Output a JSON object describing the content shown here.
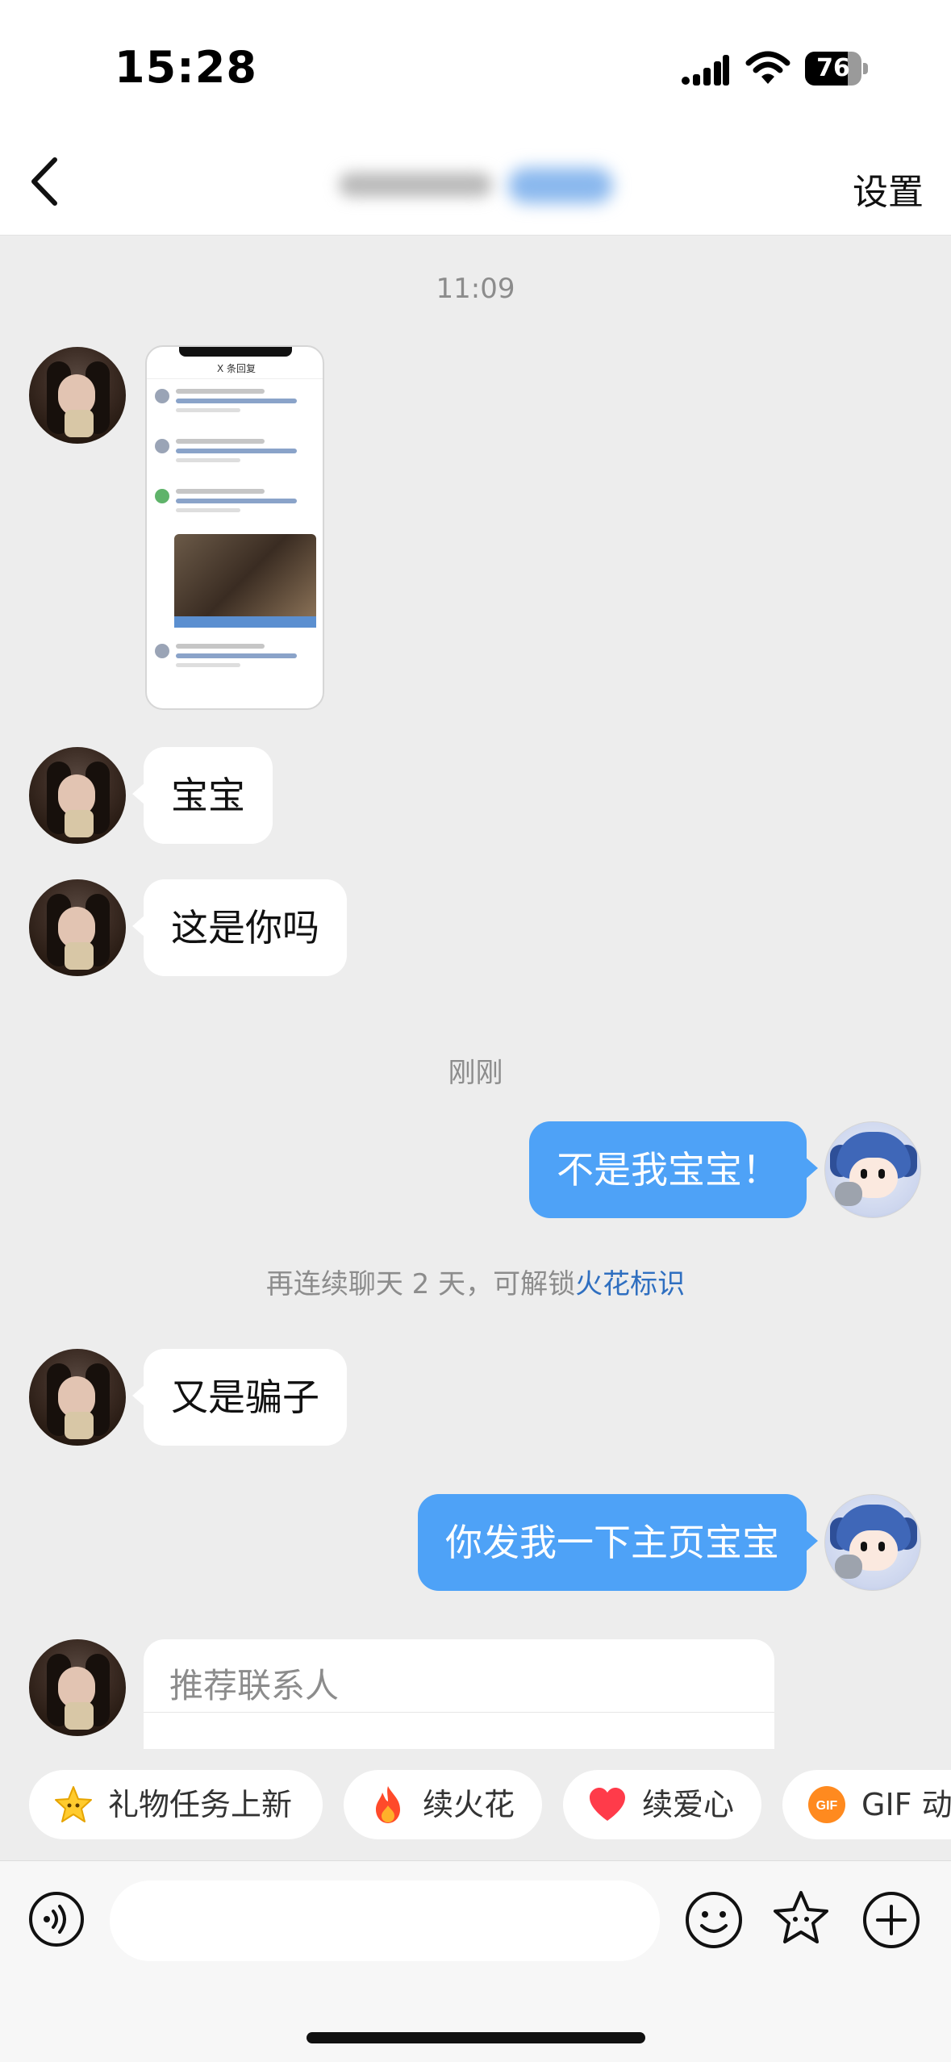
{
  "status_bar": {
    "time": "15:28",
    "battery": "76",
    "battery_level": 0.76
  },
  "header": {
    "back_icon": "chevron-left-icon",
    "title": "",
    "settings_label": "设置"
  },
  "chat": {
    "timestamp_1": "11:09",
    "image_header": "X 条回复",
    "msg_baobao": "宝宝",
    "msg_zheshini": "这是你吗",
    "timestamp_2": "刚刚",
    "msg_bushiwo": "不是我宝宝！",
    "notice_prefix": "再连续聊天 2 天，可解锁",
    "notice_link": "火花标识",
    "msg_youshipianzi": "又是骗子",
    "msg_fawo": "你发我一下主页宝宝",
    "contact_card_title": "推荐联系人"
  },
  "chips": [
    {
      "label": "礼物任务上新",
      "icon": "star-badge-icon"
    },
    {
      "label": "续火花",
      "icon": "fire-icon"
    },
    {
      "label": "续爱心",
      "icon": "heart-icon"
    },
    {
      "label": "GIF 动",
      "icon": "gif-icon",
      "icon_text": "GIF"
    }
  ],
  "input": {
    "placeholder": "",
    "value": ""
  },
  "colors": {
    "accent": "#4ea2f7",
    "link": "#2f6fc0",
    "chat_bg": "#ededed"
  }
}
